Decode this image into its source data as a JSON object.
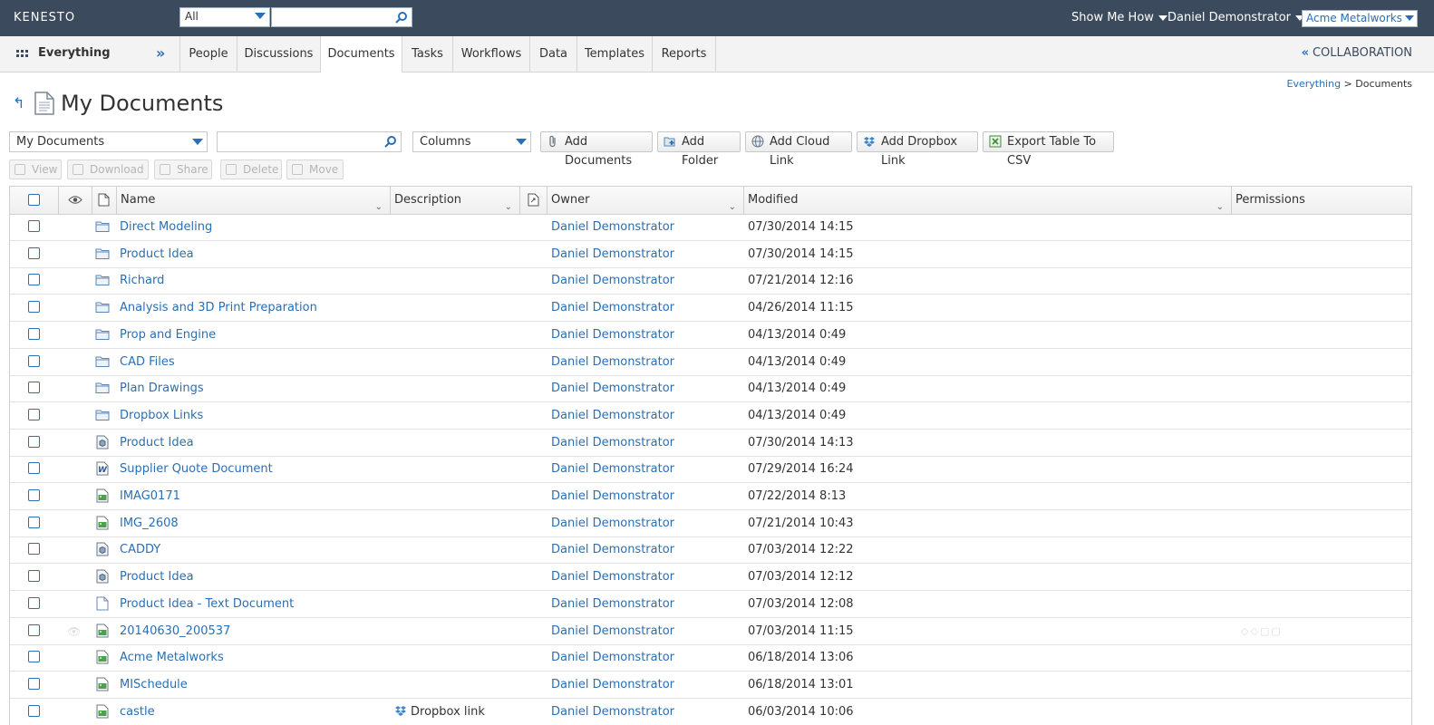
{
  "app": {
    "logo": "KENESTO"
  },
  "topbar": {
    "search_scope": "All",
    "search_value": "",
    "show_me_how": "Show Me How",
    "user": "Daniel Demonstrator",
    "company": "Acme Metalworks"
  },
  "nav": {
    "everything": "Everything",
    "tabs": [
      "People",
      "Discussions",
      "Documents",
      "Tasks",
      "Workflows",
      "Data",
      "Templates",
      "Reports"
    ],
    "active_tab": "Documents",
    "collaboration": "COLLABORATION"
  },
  "breadcrumb": {
    "root": "Everything",
    "sep": " > ",
    "current": "Documents"
  },
  "page": {
    "title": "My Documents"
  },
  "toolbar": {
    "view_select": "My Documents",
    "filter_value": "",
    "columns_select": "Columns",
    "add_documents": "Add Documents",
    "add_folder": "Add Folder",
    "add_cloud_link": "Add Cloud Link",
    "add_dropbox_link": "Add Dropbox Link",
    "export_csv": "Export Table To CSV"
  },
  "actions": {
    "view": "View",
    "download": "Download",
    "share": "Share",
    "delete": "Delete",
    "move": "Move"
  },
  "table": {
    "columns": {
      "name": "Name",
      "description": "Description",
      "owner": "Owner",
      "modified": "Modified",
      "permissions": "Permissions"
    },
    "rows": [
      {
        "type": "folder",
        "name": "Direct Modeling",
        "description": "",
        "owner": "Daniel Demonstrator",
        "modified": "07/30/2014 14:15"
      },
      {
        "type": "folder",
        "name": "Product Idea",
        "description": "",
        "owner": "Daniel Demonstrator",
        "modified": "07/30/2014 14:15"
      },
      {
        "type": "folder",
        "name": "Richard",
        "description": "",
        "owner": "Daniel Demonstrator",
        "modified": "07/21/2014 12:16"
      },
      {
        "type": "folder",
        "name": "Analysis and 3D Print Preparation",
        "description": "",
        "owner": "Daniel Demonstrator",
        "modified": "04/26/2014 11:15"
      },
      {
        "type": "folder",
        "name": "Prop and Engine",
        "description": "",
        "owner": "Daniel Demonstrator",
        "modified": "04/13/2014 0:49"
      },
      {
        "type": "folder",
        "name": "CAD Files",
        "description": "",
        "owner": "Daniel Demonstrator",
        "modified": "04/13/2014 0:49"
      },
      {
        "type": "folder",
        "name": "Plan Drawings",
        "description": "",
        "owner": "Daniel Demonstrator",
        "modified": "04/13/2014 0:49"
      },
      {
        "type": "folder",
        "name": "Dropbox Links",
        "description": "",
        "owner": "Daniel Demonstrator",
        "modified": "04/13/2014 0:49"
      },
      {
        "type": "cad",
        "name": "Product Idea",
        "description": "",
        "owner": "Daniel Demonstrator",
        "modified": "07/30/2014 14:13"
      },
      {
        "type": "word",
        "name": "Supplier Quote Document",
        "description": "",
        "owner": "Daniel Demonstrator",
        "modified": "07/29/2014 16:24"
      },
      {
        "type": "image",
        "name": "IMAG0171",
        "description": "",
        "owner": "Daniel Demonstrator",
        "modified": "07/22/2014 8:13"
      },
      {
        "type": "image",
        "name": "IMG_2608",
        "description": "",
        "owner": "Daniel Demonstrator",
        "modified": "07/21/2014 10:43"
      },
      {
        "type": "cad",
        "name": "CADDY",
        "description": "",
        "owner": "Daniel Demonstrator",
        "modified": "07/03/2014 12:22"
      },
      {
        "type": "cad",
        "name": "Product Idea",
        "description": "",
        "owner": "Daniel Demonstrator",
        "modified": "07/03/2014 12:12"
      },
      {
        "type": "text",
        "name": "Product Idea - Text Document",
        "description": "",
        "owner": "Daniel Demonstrator",
        "modified": "07/03/2014 12:08"
      },
      {
        "type": "image",
        "name": "20140630_200537",
        "description": "",
        "owner": "Daniel Demonstrator",
        "modified": "07/03/2014 11:15",
        "hover": true
      },
      {
        "type": "image",
        "name": "Acme Metalworks",
        "description": "",
        "owner": "Daniel Demonstrator",
        "modified": "06/18/2014 13:06"
      },
      {
        "type": "image",
        "name": "MISchedule",
        "description": "",
        "owner": "Daniel Demonstrator",
        "modified": "06/18/2014 13:01"
      },
      {
        "type": "image",
        "name": "castle",
        "description": "Dropbox link",
        "owner": "Daniel Demonstrator",
        "modified": "06/03/2014 10:06"
      }
    ]
  },
  "colors": {
    "topbar": "#3b4a5c",
    "link": "#2a6fb5",
    "folder": "#5b86b8",
    "image": "#3c9a3c"
  }
}
